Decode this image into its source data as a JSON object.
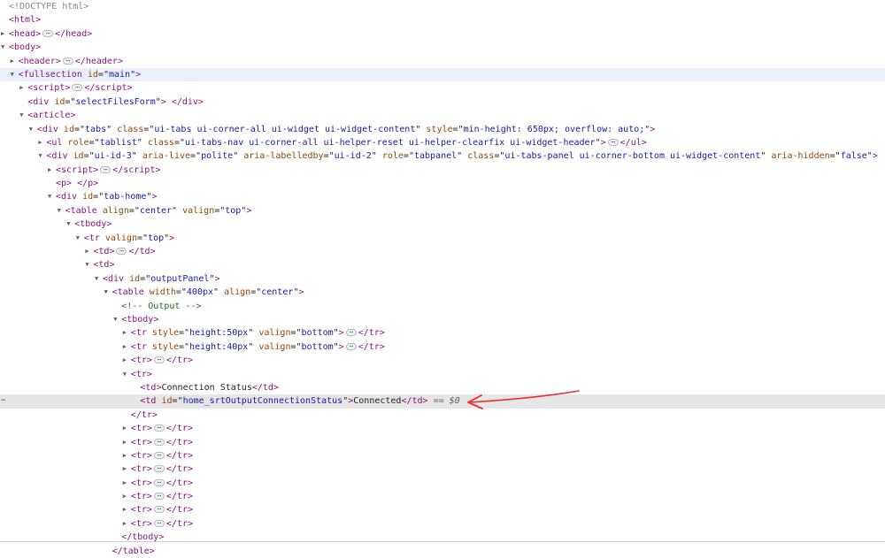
{
  "colors": {
    "tag": "#881280",
    "attr_name": "#994500",
    "attr_value": "#1a1aa6",
    "comment": "#236e25",
    "doctype": "#8a8a8a",
    "highlight_main": "#e9f0fb",
    "highlight_selected": "#e6e6e6",
    "arrow": "#e8302c"
  },
  "icons": {
    "expand": "triangle-right-icon",
    "collapse": "triangle-down-icon",
    "ellipsis": "ellipsis-icon",
    "annotation": "red-arrow-icon"
  },
  "selected_suffix": "== $0",
  "gutter_text": "⋯",
  "nodes": [
    {
      "depth": 0,
      "toggle": "",
      "kind": "doctype",
      "text": "<!DOCTYPE html>"
    },
    {
      "depth": 0,
      "toggle": "",
      "kind": "open",
      "tag": "html",
      "attrs": []
    },
    {
      "depth": 0,
      "toggle": "right",
      "kind": "collapsed",
      "tag": "head",
      "attrs": []
    },
    {
      "depth": 0,
      "toggle": "down",
      "kind": "open",
      "tag": "body",
      "attrs": []
    },
    {
      "depth": 1,
      "toggle": "right",
      "kind": "collapsed",
      "tag": "header",
      "attrs": []
    },
    {
      "depth": 1,
      "toggle": "down",
      "kind": "open",
      "tag": "fullsection",
      "attrs": [
        {
          "name": "id",
          "value": "main"
        }
      ],
      "highlight": "main"
    },
    {
      "depth": 2,
      "toggle": "right",
      "kind": "collapsed",
      "tag": "script",
      "attrs": []
    },
    {
      "depth": 2,
      "toggle": "",
      "kind": "inline",
      "tag": "div",
      "attrs": [
        {
          "name": "id",
          "value": "selectFilesForm"
        }
      ],
      "text": " "
    },
    {
      "depth": 2,
      "toggle": "down",
      "kind": "open",
      "tag": "article",
      "attrs": []
    },
    {
      "depth": 3,
      "toggle": "down",
      "kind": "open",
      "tag": "div",
      "attrs": [
        {
          "name": "id",
          "value": "tabs"
        },
        {
          "name": "class",
          "value": "ui-tabs ui-corner-all ui-widget ui-widget-content"
        },
        {
          "name": "style",
          "value": "min-height: 650px; overflow: auto;"
        }
      ]
    },
    {
      "depth": 4,
      "toggle": "right",
      "kind": "collapsed",
      "tag": "ul",
      "attrs": [
        {
          "name": "role",
          "value": "tablist"
        },
        {
          "name": "class",
          "value": "ui-tabs-nav ui-corner-all ui-helper-reset ui-helper-clearfix ui-widget-header"
        }
      ]
    },
    {
      "depth": 4,
      "toggle": "down",
      "kind": "open",
      "tag": "div",
      "attrs": [
        {
          "name": "id",
          "value": "ui-id-3"
        },
        {
          "name": "aria-live",
          "value": "polite"
        },
        {
          "name": "aria-labelledby",
          "value": "ui-id-2"
        },
        {
          "name": "role",
          "value": "tabpanel"
        },
        {
          "name": "class",
          "value": "ui-tabs-panel ui-corner-bottom ui-widget-content"
        },
        {
          "name": "aria-hidden",
          "value": "false"
        }
      ]
    },
    {
      "depth": 5,
      "toggle": "right",
      "kind": "collapsed",
      "tag": "script",
      "attrs": []
    },
    {
      "depth": 5,
      "toggle": "",
      "kind": "inline",
      "tag": "p",
      "attrs": [],
      "text": " "
    },
    {
      "depth": 5,
      "toggle": "down",
      "kind": "open",
      "tag": "div",
      "attrs": [
        {
          "name": "id",
          "value": "tab-home"
        }
      ]
    },
    {
      "depth": 6,
      "toggle": "down",
      "kind": "open",
      "tag": "table",
      "attrs": [
        {
          "name": "align",
          "value": "center"
        },
        {
          "name": "valign",
          "value": "top"
        }
      ]
    },
    {
      "depth": 7,
      "toggle": "down",
      "kind": "open",
      "tag": "tbody",
      "attrs": []
    },
    {
      "depth": 8,
      "toggle": "down",
      "kind": "open",
      "tag": "tr",
      "attrs": [
        {
          "name": "valign",
          "value": "top"
        }
      ]
    },
    {
      "depth": 9,
      "toggle": "right",
      "kind": "collapsed",
      "tag": "td",
      "attrs": []
    },
    {
      "depth": 9,
      "toggle": "down",
      "kind": "open",
      "tag": "td",
      "attrs": []
    },
    {
      "depth": 10,
      "toggle": "down",
      "kind": "open",
      "tag": "div",
      "attrs": [
        {
          "name": "id",
          "value": "outputPanel"
        }
      ]
    },
    {
      "depth": 11,
      "toggle": "down",
      "kind": "open",
      "tag": "table",
      "attrs": [
        {
          "name": "width",
          "value": "400px"
        },
        {
          "name": "align",
          "value": "center"
        }
      ]
    },
    {
      "depth": 12,
      "toggle": "",
      "kind": "comment",
      "text": "<!-- Output -->"
    },
    {
      "depth": 12,
      "toggle": "down",
      "kind": "open",
      "tag": "tbody",
      "attrs": []
    },
    {
      "depth": 13,
      "toggle": "right",
      "kind": "collapsed",
      "tag": "tr",
      "attrs": [
        {
          "name": "style",
          "value": "height:50px"
        },
        {
          "name": "valign",
          "value": "bottom"
        }
      ]
    },
    {
      "depth": 13,
      "toggle": "right",
      "kind": "collapsed",
      "tag": "tr",
      "attrs": [
        {
          "name": "style",
          "value": "height:40px"
        },
        {
          "name": "valign",
          "value": "bottom"
        }
      ]
    },
    {
      "depth": 13,
      "toggle": "right",
      "kind": "collapsed",
      "tag": "tr",
      "attrs": []
    },
    {
      "depth": 13,
      "toggle": "down",
      "kind": "open",
      "tag": "tr",
      "attrs": []
    },
    {
      "depth": 14,
      "toggle": "",
      "kind": "inline",
      "tag": "td",
      "attrs": [],
      "text": "Connection Status"
    },
    {
      "depth": 14,
      "toggle": "",
      "kind": "inline",
      "tag": "td",
      "attrs": [
        {
          "name": "id",
          "value": "home_srtOutputConnectionStatus"
        }
      ],
      "text": "Connected",
      "highlight": "selected"
    },
    {
      "depth": 13,
      "toggle": "",
      "kind": "close",
      "tag": "tr"
    },
    {
      "depth": 13,
      "toggle": "right",
      "kind": "collapsed",
      "tag": "tr",
      "attrs": []
    },
    {
      "depth": 13,
      "toggle": "right",
      "kind": "collapsed",
      "tag": "tr",
      "attrs": []
    },
    {
      "depth": 13,
      "toggle": "right",
      "kind": "collapsed",
      "tag": "tr",
      "attrs": []
    },
    {
      "depth": 13,
      "toggle": "right",
      "kind": "collapsed",
      "tag": "tr",
      "attrs": []
    },
    {
      "depth": 13,
      "toggle": "right",
      "kind": "collapsed",
      "tag": "tr",
      "attrs": []
    },
    {
      "depth": 13,
      "toggle": "right",
      "kind": "collapsed",
      "tag": "tr",
      "attrs": []
    },
    {
      "depth": 13,
      "toggle": "right",
      "kind": "collapsed",
      "tag": "tr",
      "attrs": []
    },
    {
      "depth": 13,
      "toggle": "right",
      "kind": "collapsed",
      "tag": "tr",
      "attrs": []
    },
    {
      "depth": 12,
      "toggle": "",
      "kind": "close",
      "tag": "tbody"
    },
    {
      "depth": 11,
      "toggle": "",
      "kind": "close",
      "tag": "table"
    }
  ]
}
